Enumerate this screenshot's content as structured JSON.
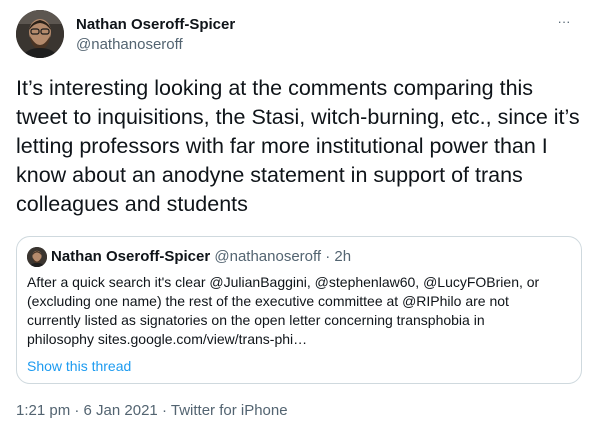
{
  "author": {
    "display_name": "Nathan Oseroff-Spicer",
    "handle": "@nathanoseroff",
    "avatar_icon": "avatar-photo"
  },
  "more_icon": "ellipsis-icon",
  "more_label": "···",
  "tweet_text": "It’s interesting looking at the comments comparing this tweet to inquisitions, the Stasi, witch-burning, etc., since it’s letting professors with far more institutional power than I know about an anodyne statement in support of trans colleagues and students",
  "quoted": {
    "display_name": "Nathan Oseroff-Spicer",
    "handle": "@nathanoseroff",
    "separator": "·",
    "time": "2h",
    "text_line1": "After a quick search it's clear @JulianBaggini, @stephenlaw60, @LucyFOBrien, or",
    "text_line2": "(excluding one name) the rest of the executive committee at @RIPhilo are not",
    "text_line3": "currently listed as signatories on the open letter concerning transphobia in",
    "text_line4": "philosophy sites.google.com/view/trans-phi…",
    "show_thread": "Show this thread"
  },
  "meta": {
    "time": "1:21 pm",
    "sep1": "·",
    "date": "6 Jan 2021",
    "sep2": "·",
    "source": "Twitter for iPhone"
  },
  "colors": {
    "text": "#0f1419",
    "secondary": "#536471",
    "link": "#1d9bf0",
    "border": "#cfd9de"
  }
}
